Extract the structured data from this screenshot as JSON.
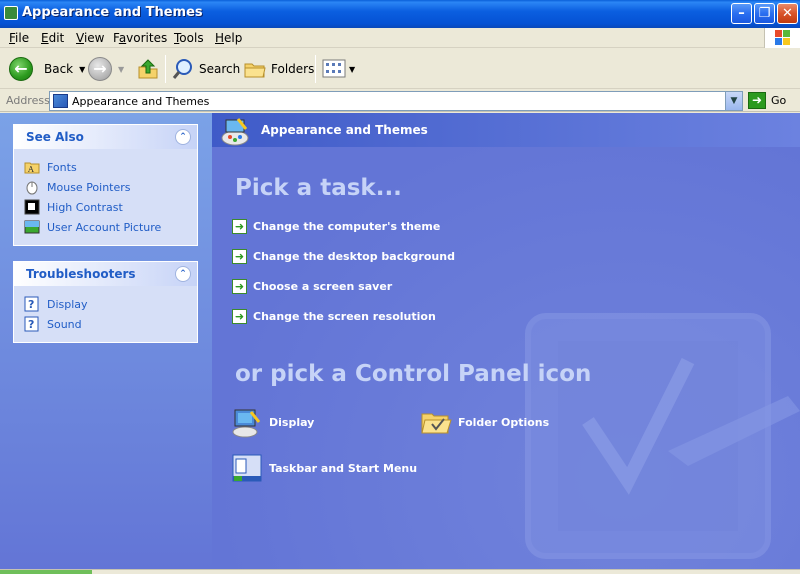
{
  "window": {
    "title": "Appearance and Themes",
    "controls": [
      "minimize-icon",
      "maximize-icon",
      "close-icon"
    ]
  },
  "menu": {
    "items": [
      "File",
      "Edit",
      "View",
      "Favorites",
      "Tools",
      "Help"
    ],
    "underline": [
      "F",
      "E",
      "V",
      "a",
      "T",
      "H"
    ]
  },
  "toolbar": {
    "back_label": "Back",
    "search_label": "Search",
    "folders_label": "Folders"
  },
  "address": {
    "label": "Address",
    "value": "Appearance and Themes",
    "go_label": "Go"
  },
  "see_also": {
    "title": "See Also",
    "items": [
      {
        "label": "Fonts",
        "icon": "fonts-folder-icon"
      },
      {
        "label": "Mouse Pointers",
        "icon": "mouse-icon"
      },
      {
        "label": "High Contrast",
        "icon": "high-contrast-icon"
      },
      {
        "label": "User Account Picture",
        "icon": "user-picture-icon"
      }
    ]
  },
  "troubleshooters": {
    "title": "Troubleshooters",
    "items": [
      {
        "label": "Display",
        "icon": "help-icon"
      },
      {
        "label": "Sound",
        "icon": "help-icon"
      }
    ]
  },
  "content": {
    "header_title": "Appearance and Themes",
    "pick_task_heading": "Pick a task...",
    "tasks": [
      "Change the computer's theme",
      "Change the desktop background",
      "Choose a screen saver",
      "Change the screen resolution"
    ],
    "pick_icon_heading": "or pick a Control Panel icon",
    "icons": [
      {
        "label": "Display",
        "icon": "display-icon"
      },
      {
        "label": "Folder Options",
        "icon": "folder-options-icon"
      },
      {
        "label": "Taskbar and Start Menu",
        "icon": "taskbar-icon"
      }
    ]
  },
  "colors": {
    "titlebar": "#0552d4",
    "content_bg": "#6375d6",
    "link_blue": "#215dc6",
    "heading_light": "#c6d3f7"
  }
}
